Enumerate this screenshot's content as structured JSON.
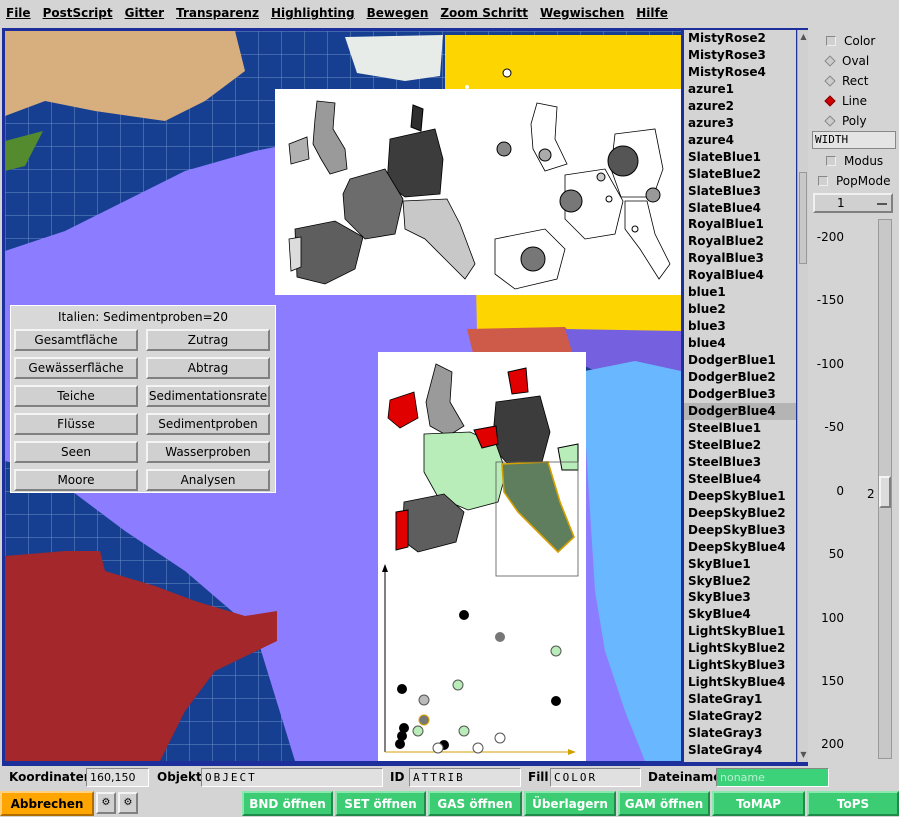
{
  "menu": [
    "File",
    "PostScript",
    "Gitter",
    "Transparenz",
    "Highlighting",
    "Bewegen",
    "Zoom Schritt",
    "Wegwischen",
    "Hilfe"
  ],
  "panel": {
    "title": "Italien: Sedimentproben=20",
    "buttons_left": [
      "Gesamtfläche",
      "Gewässerfläche",
      "Teiche",
      "Flüsse",
      "Seen",
      "Moore"
    ],
    "buttons_right": [
      "Zutrag",
      "Abtrag",
      "Sedimentationsrate",
      "Sedimentproben",
      "Wasserproben",
      "Analysen"
    ]
  },
  "color_list": {
    "items": [
      "MistyRose2",
      "MistyRose3",
      "MistyRose4",
      "azure1",
      "azure2",
      "azure3",
      "azure4",
      "SlateBlue1",
      "SlateBlue2",
      "SlateBlue3",
      "SlateBlue4",
      "RoyalBlue1",
      "RoyalBlue2",
      "RoyalBlue3",
      "RoyalBlue4",
      "blue1",
      "blue2",
      "blue3",
      "blue4",
      "DodgerBlue1",
      "DodgerBlue2",
      "DodgerBlue3",
      "DodgerBlue4",
      "SteelBlue1",
      "SteelBlue2",
      "SteelBlue3",
      "SteelBlue4",
      "DeepSkyBlue1",
      "DeepSkyBlue2",
      "DeepSkyBlue3",
      "DeepSkyBlue4",
      "SkyBlue1",
      "SkyBlue2",
      "SkyBlue3",
      "SkyBlue4",
      "LightSkyBlue1",
      "LightSkyBlue2",
      "LightSkyBlue3",
      "LightSkyBlue4",
      "SlateGray1",
      "SlateGray2",
      "SlateGray3",
      "SlateGray4"
    ],
    "selected": "DodgerBlue4"
  },
  "tools": {
    "color_label": "Color",
    "shapes": [
      "Oval",
      "Rect",
      "Line",
      "Poly"
    ],
    "selected_shape": "Line",
    "width_field": "WIDTH",
    "modus_label": "Modus",
    "popmode_label": "PopMode",
    "width_value": "1",
    "scale_labels": [
      "-200",
      "-150",
      "-100",
      "-50",
      "0",
      "50",
      "100",
      "150",
      "200"
    ],
    "scale_value": "2"
  },
  "status": {
    "coords_label": "Koordinaten",
    "coords_value": "160,150",
    "object_label": "Objekt",
    "object_value": "OBJECT",
    "id_label": "ID",
    "id_value": "ATTRIB",
    "fill_label": "Fill",
    "fill_value": "COLOR",
    "filename_label": "Dateiname",
    "filename_value": "noname"
  },
  "bottom_buttons": {
    "cancel": "Abbrechen",
    "bnd": "BND öffnen",
    "set": "SET öffnen",
    "gas": "GAS öffnen",
    "overlay": "Überlagern",
    "gam": "GAM öffnen",
    "tomap": "ToMAP",
    "tops": "ToPS"
  },
  "colors": {
    "map_blue": "#163f91",
    "grid": "#6b8cc7",
    "lavender": "#8c7cff",
    "crimson": "#a3272b",
    "gold": "#fdd500",
    "lightblue": "#69b8ff",
    "tan": "#d7ae7d",
    "button_green": "#3ccc73",
    "button_orange": "#ffa500"
  }
}
